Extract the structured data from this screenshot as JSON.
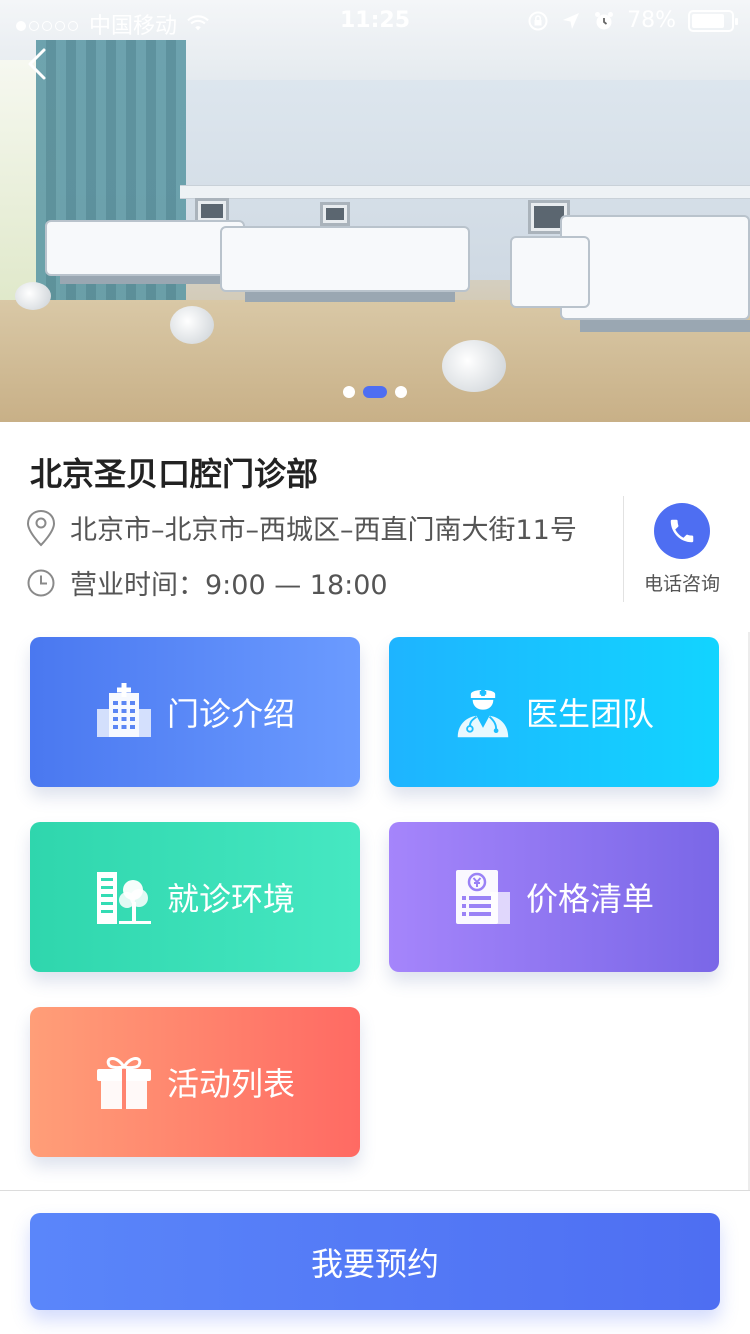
{
  "status_bar": {
    "carrier": "中国移动",
    "time": "11:25",
    "battery": "78%",
    "signal_strength": 1,
    "battery_level": 0.78
  },
  "carousel": {
    "slide_count": 3,
    "active_index": 1
  },
  "clinic": {
    "name": "北京圣贝口腔门诊部",
    "address": "北京市–北京市–西城区–西直门南大街11号",
    "hours_label": "营业时间：",
    "hours_value": "9:00 — 18:00",
    "phone_label": "电话咨询"
  },
  "services": [
    {
      "label": "门诊介绍",
      "icon": "hospital-building-icon"
    },
    {
      "label": "医生团队",
      "icon": "doctor-icon"
    },
    {
      "label": "就诊环境",
      "icon": "building-tree-icon"
    },
    {
      "label": "价格清单",
      "icon": "price-list-icon"
    },
    {
      "label": "活动列表",
      "icon": "gift-icon"
    }
  ],
  "colors": {
    "accent": "#4E6EF2",
    "card_intro": "#4A78F0",
    "card_doctors": "#1EB4FF",
    "card_environment": "#2FD6AD",
    "card_price": "#A585FB",
    "card_activity": "#FF6A63"
  },
  "booking": {
    "label": "我要预约"
  }
}
